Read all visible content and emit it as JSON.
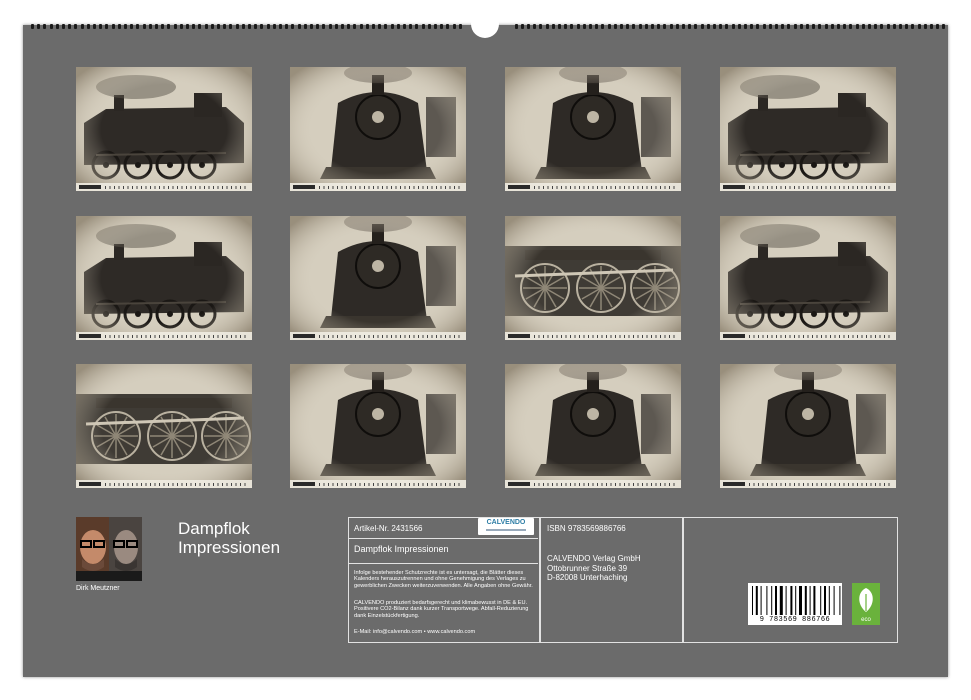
{
  "calendar": {
    "background": "#6b6b6b",
    "months": [
      {
        "theme": "locomotive-side"
      },
      {
        "theme": "locomotive-front"
      },
      {
        "theme": "locomotive-front"
      },
      {
        "theme": "locomotive-side"
      },
      {
        "theme": "locomotive-side"
      },
      {
        "theme": "locomotive-front"
      },
      {
        "theme": "locomotive-wheels"
      },
      {
        "theme": "locomotive-side"
      },
      {
        "theme": "locomotive-wheels"
      },
      {
        "theme": "locomotive-front"
      },
      {
        "theme": "locomotive-front"
      },
      {
        "theme": "locomotive-front"
      }
    ]
  },
  "author": {
    "name": "Dirk Meutzner"
  },
  "title": {
    "line1": "Dampflok",
    "line2": "Impressionen"
  },
  "info": {
    "article": "Artikel-Nr. 2431566",
    "logo": "CALVENDO",
    "product_title": "Dampflok Impressionen",
    "legal": "Infolge bestehender Schutzrechte ist es untersagt, die Blätter dieses Kalenders herauszutrennen und ohne Genehmigung des Verlages zu gewerblichen Zwecken weiterzuverwenden. Alle Angaben ohne Gewähr.",
    "eco_note": "CALVENDO produziert bedarfsgerecht und klimabewusst in DE & EU. Positivere CO2-Bilanz dank kurzer Transportwege. Abfall-Reduzierung dank Einzelstückfertigung.",
    "contact": "E-Mail: info@calvendo.com • www.calvendo.com",
    "isbn": "ISBN 9783569886766",
    "publisher": "CALVENDO Verlag GmbH",
    "street": "Ottobrunner Straße 39",
    "city": "D-82008 Unterhaching",
    "barcode_number": "9 783569 886766",
    "eco_label": "eco"
  },
  "colors": {
    "eco_green": "#6ab23c",
    "logo_blue": "#2e7ea6",
    "sepia": "#cdc6b6"
  }
}
